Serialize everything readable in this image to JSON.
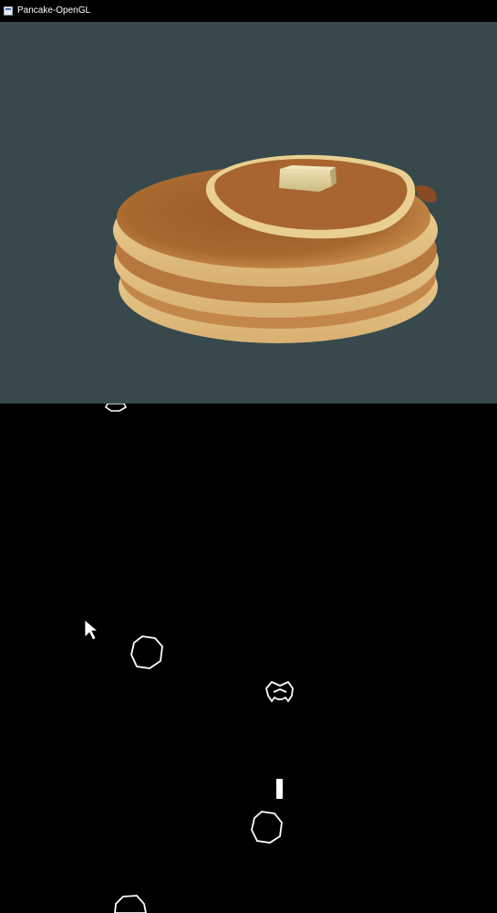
{
  "window": {
    "title": "Pancake-OpenGL",
    "icon": "app-window-icon"
  },
  "scene": {
    "background_color": "#37494c",
    "object": "pancake-stack",
    "pancake_count": 3,
    "topping": "butter-pat"
  },
  "game": {
    "background_color": "#000000",
    "asteroid_count": 4,
    "ships": [
      "enemy-saucer"
    ],
    "projectiles": 1,
    "cursor": "arrow-cursor"
  },
  "colors": {
    "outline": "#ffffff",
    "pancake_edge": "#e7c98a",
    "pancake_top": "#a8672f",
    "butter": "#e3d3a0"
  }
}
